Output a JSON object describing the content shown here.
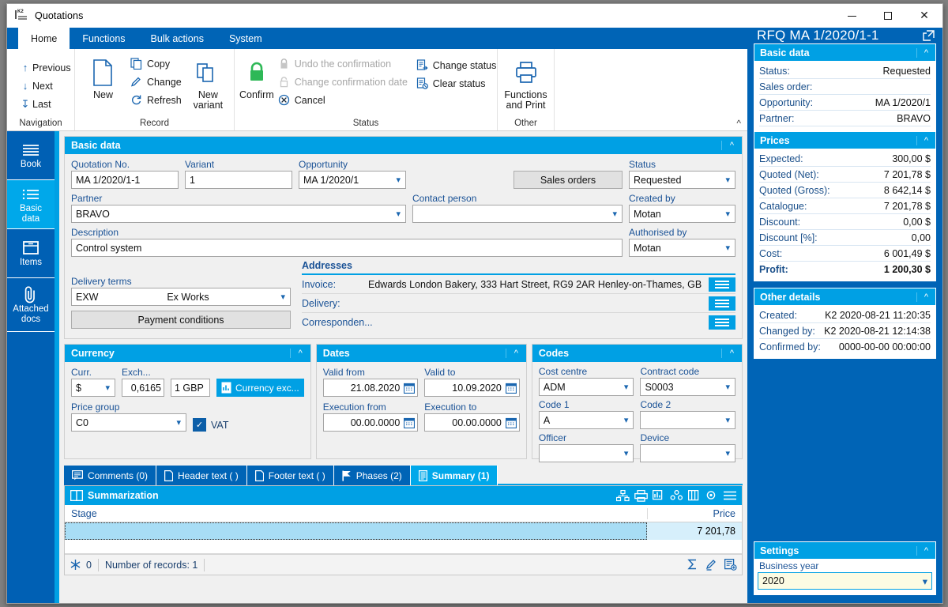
{
  "window": {
    "title": "Quotations",
    "app_icon": "k2-icon",
    "controls": {
      "minimize": "minimize-icon",
      "maximize": "maximize-icon",
      "close": "close-icon"
    }
  },
  "ribbon": {
    "tabs": [
      {
        "label": "Home",
        "active": true
      },
      {
        "label": "Functions",
        "active": false
      },
      {
        "label": "Bulk actions",
        "active": false
      },
      {
        "label": "System",
        "active": false
      }
    ],
    "groups": {
      "navigation": {
        "label": "Navigation",
        "items": [
          {
            "label": "Previous",
            "icon": "arrow-up-icon"
          },
          {
            "label": "Next",
            "icon": "arrow-down-icon"
          },
          {
            "label": "Last",
            "icon": "arrow-down-bar-icon"
          }
        ]
      },
      "record": {
        "label": "Record",
        "new_label": "New",
        "new_variant_label": "New\nvariant",
        "new_variant_line1": "New",
        "new_variant_line2": "variant",
        "items": [
          {
            "label": "Copy",
            "icon": "copy-icon"
          },
          {
            "label": "Change",
            "icon": "pencil-icon"
          },
          {
            "label": "Refresh",
            "icon": "refresh-icon"
          }
        ]
      },
      "status": {
        "label": "Status",
        "confirm_label": "Confirm",
        "items": [
          {
            "label": "Undo the confirmation",
            "icon": "lock-icon",
            "disabled": true
          },
          {
            "label": "Change confirmation date",
            "icon": "lock-open-icon",
            "disabled": true
          },
          {
            "label": "Cancel",
            "icon": "cancel-icon",
            "disabled": false
          }
        ],
        "items2": [
          {
            "label": "Change status",
            "icon": "change-status-icon"
          },
          {
            "label": "Clear status",
            "icon": "clear-status-icon"
          }
        ]
      },
      "other": {
        "label": "Other",
        "print_line1": "Functions",
        "print_line2": "and Print",
        "icon": "printer-icon"
      }
    },
    "collapse_icon": "chevron-up-icon"
  },
  "sidebar": {
    "items": [
      {
        "label": "Book",
        "icon": "book-lines-icon",
        "active": false
      },
      {
        "label_line1": "Basic",
        "label_line2": "data",
        "icon": "list-icon",
        "active": true
      },
      {
        "label": "Items",
        "icon": "box-icon",
        "active": false
      },
      {
        "label_line1": "Attached",
        "label_line2": "docs",
        "icon": "paperclip-icon",
        "active": false
      }
    ]
  },
  "basic_data": {
    "title": "Basic data",
    "chevron": "chevron-up-icon",
    "fields": {
      "quotation_no": {
        "label": "Quotation No.",
        "value": "MA 1/2020/1-1"
      },
      "variant": {
        "label": "Variant",
        "value": "1"
      },
      "opportunity": {
        "label": "Opportunity",
        "value": "MA 1/2020/1"
      },
      "status": {
        "label": "Status",
        "value": "Requested"
      },
      "partner": {
        "label": "Partner",
        "value": "BRAVO"
      },
      "contact_person": {
        "label": "Contact person",
        "value": ""
      },
      "created_by": {
        "label": "Created by",
        "value": "Motan"
      },
      "description": {
        "label": "Description",
        "value": "Control system"
      },
      "authorised_by": {
        "label": "Authorised by",
        "value": "Motan"
      },
      "delivery_terms": {
        "label": "Delivery terms",
        "value": "EXW",
        "suffix": "Ex Works"
      }
    },
    "sales_orders_button": "Sales orders",
    "payment_conditions_button": "Payment conditions",
    "addresses": {
      "title": "Addresses",
      "rows": [
        {
          "label": "Invoice:",
          "value": "Edwards London Bakery,  333  Hart Street, RG9 2AR  Henley-on-Thames, GB"
        },
        {
          "label": "Delivery:",
          "value": ""
        },
        {
          "label": "Corresponden...",
          "value": ""
        }
      ]
    }
  },
  "currency_panel": {
    "title": "Currency",
    "curr_label": "Curr.",
    "curr_value": "$",
    "exch_label": "Exch...",
    "exch_value": "0,6165",
    "exch_unit": "1 GBP",
    "currency_exchange_button": "Currency exc...",
    "price_group_label": "Price group",
    "price_group_value": "C0",
    "vat_label": "VAT",
    "vat_checked": true
  },
  "dates_panel": {
    "title": "Dates",
    "fields": [
      {
        "label": "Valid from",
        "value": "21.08.2020"
      },
      {
        "label": "Valid to",
        "value": "10.09.2020"
      },
      {
        "label": "Execution from",
        "value": "00.00.0000"
      },
      {
        "label": "Execution to",
        "value": "00.00.0000"
      }
    ]
  },
  "codes_panel": {
    "title": "Codes",
    "fields": [
      {
        "label": "Cost centre",
        "value": "ADM"
      },
      {
        "label": "Contract code",
        "value": "S0003"
      },
      {
        "label": "Code 1",
        "value": "A"
      },
      {
        "label": "Code 2",
        "value": ""
      },
      {
        "label": "Officer",
        "value": ""
      },
      {
        "label": "Device",
        "value": ""
      }
    ]
  },
  "detail_tabs": [
    {
      "label": "Comments (0)",
      "icon": "comment-icon",
      "active": false
    },
    {
      "label": "Header text ( )",
      "icon": "document-icon",
      "active": false
    },
    {
      "label": "Footer text ( )",
      "icon": "document-icon",
      "active": false
    },
    {
      "label": "Phases (2)",
      "icon": "flag-icon",
      "active": false
    },
    {
      "label": "Summary (1)",
      "icon": "list-doc-icon",
      "active": true
    }
  ],
  "summarization": {
    "title": "Summarization",
    "title_icon": "book-open-icon",
    "toolbar_icons": [
      "hierarchy-icon",
      "printer-icon",
      "bar-chart-icon",
      "pivot-icon",
      "columns-icon",
      "settings-gear-icon",
      "menu-icon"
    ],
    "columns": [
      "Stage",
      "Price"
    ],
    "rows": [
      {
        "stage": "",
        "price": "7 201,78"
      }
    ],
    "footer": {
      "snowflake_icon": "snowflake-icon",
      "snowflake_count": "0",
      "records_text": "Number of records: 1",
      "right_icons": [
        "sum-icon",
        "edit-icon",
        "add-record-icon"
      ]
    }
  },
  "right_panel": {
    "title": "RFQ  MA 1/2020/1-1",
    "popout_icon": "popout-icon",
    "basic_data": {
      "title": "Basic data",
      "rows": [
        {
          "key": "Status:",
          "value": "Requested"
        },
        {
          "key": "Sales order:",
          "value": ""
        },
        {
          "key": "Opportunity:",
          "value": "MA 1/2020/1"
        },
        {
          "key": "Partner:",
          "value": "BRAVO"
        }
      ]
    },
    "prices": {
      "title": "Prices",
      "rows": [
        {
          "key": "Expected:",
          "value": "300,00 $",
          "bold": false
        },
        {
          "key": "Quoted (Net):",
          "value": "7 201,78 $",
          "bold": false
        },
        {
          "key": "Quoted (Gross):",
          "value": "8 642,14 $",
          "bold": false
        },
        {
          "key": "Catalogue:",
          "value": "7 201,78 $",
          "bold": false
        },
        {
          "key": "Discount:",
          "value": "0,00 $",
          "bold": false
        },
        {
          "key": "Discount [%]:",
          "value": "0,00",
          "bold": false
        },
        {
          "key": "Cost:",
          "value": "6 001,49 $",
          "bold": false
        },
        {
          "key": "Profit:",
          "value": "1 200,30 $",
          "bold": true
        }
      ]
    },
    "other_details": {
      "title": "Other details",
      "rows": [
        {
          "key": "Created:",
          "value": "K2 2020-08-21 11:20:35"
        },
        {
          "key": "Changed by:",
          "value": "K2 2020-08-21 12:14:38"
        },
        {
          "key": "Confirmed by:",
          "value": "0000-00-00 00:00:00"
        }
      ]
    },
    "settings": {
      "title": "Settings",
      "business_year_label": "Business year",
      "business_year_value": "2020"
    }
  },
  "colors": {
    "ribbon_blue": "#0064b6",
    "accent_cyan": "#00a0e4",
    "sidebar_blue": "#0060b4",
    "active_cyan": "#00a8ea",
    "label_blue": "#1a5296",
    "confirm_green": "#2eb857"
  }
}
